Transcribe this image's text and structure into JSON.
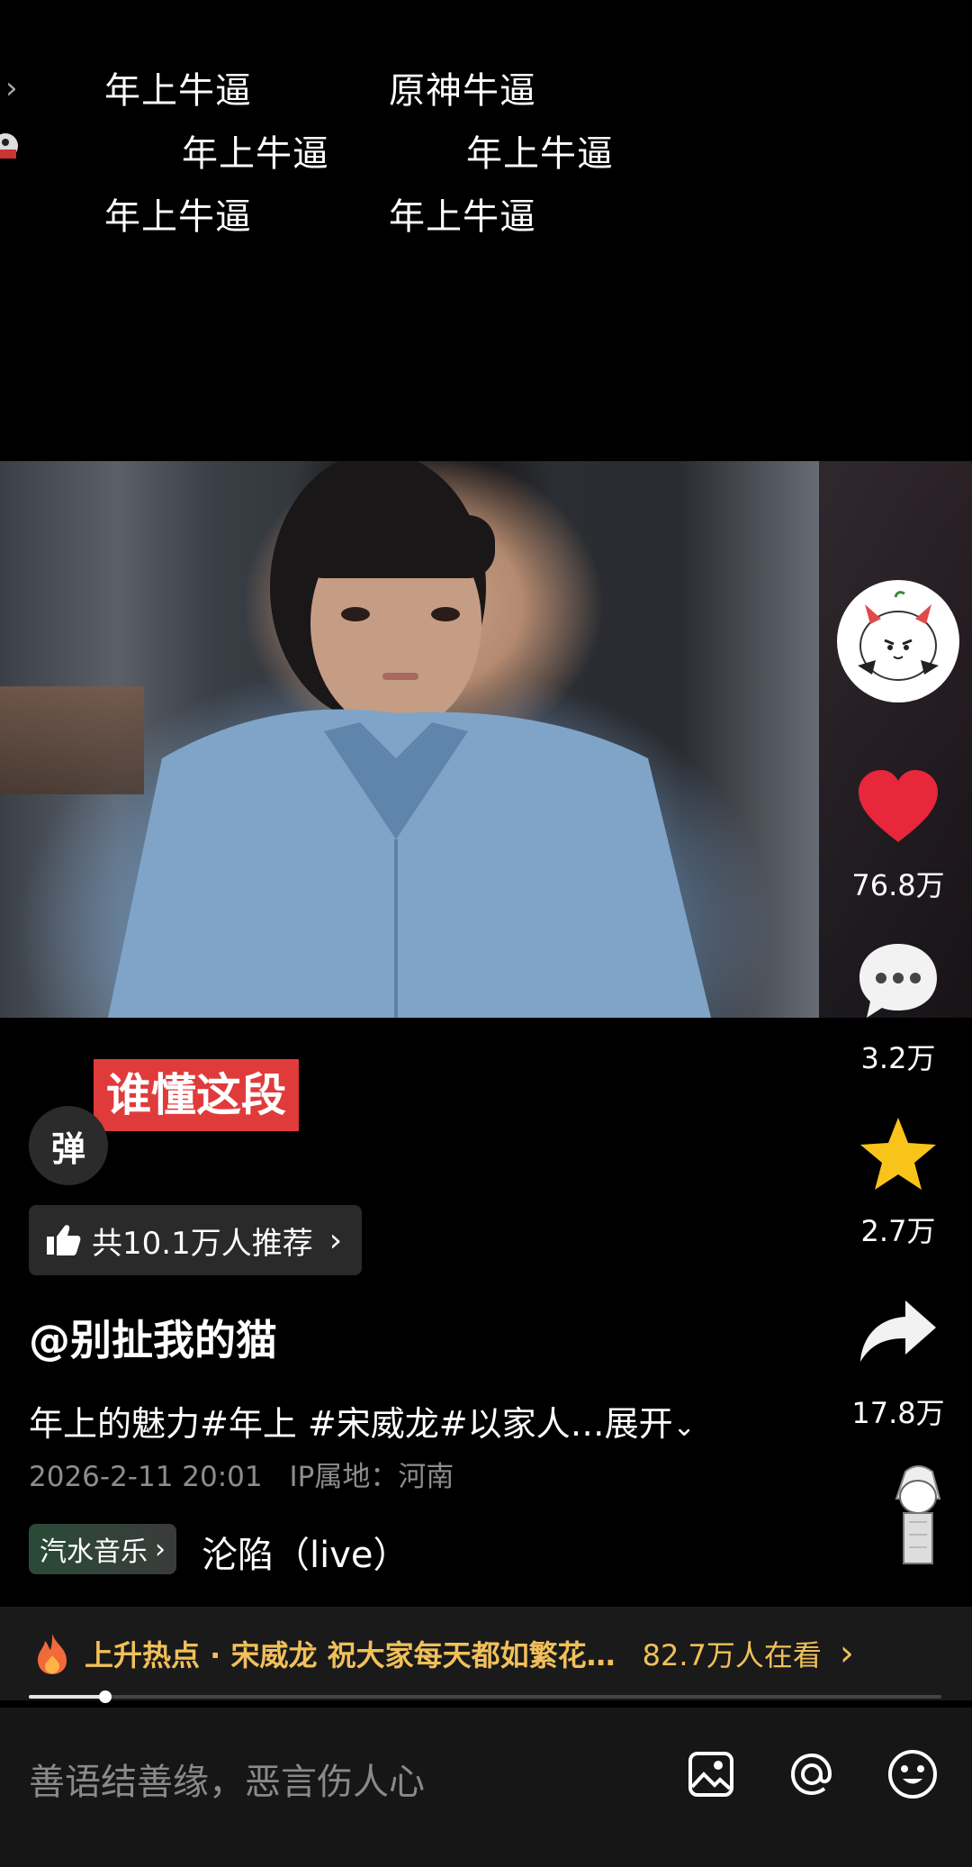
{
  "danmu": {
    "line1_a": "年上牛逼",
    "line1_b": "原神牛逼",
    "line2_a": "年上牛逼",
    "line2_b": "年上牛逼",
    "line3_a": "年上牛逼",
    "line3_b": "年上牛逼"
  },
  "top_left": {
    "chevron": "›"
  },
  "sidebar": {
    "avatar_icon": "devil-sticker-avatar",
    "likes": "76.8万",
    "comments": "3.2万",
    "favorites": "2.7万",
    "shares": "17.8万",
    "like_color": "#e8263c",
    "star_color": "#f8c41a"
  },
  "video": {
    "tag_label": "谁懂这段"
  },
  "danmu_toggle": {
    "label": "弹"
  },
  "recommend": {
    "label": "共10.1万人推荐"
  },
  "post": {
    "username": "@别扯我的猫",
    "description": "年上的魅力#年上 #宋威龙#以家人…",
    "expand_label": "展开",
    "date": "2026-2-11 20:01",
    "ip": "IP属地：河南"
  },
  "music": {
    "app_label": "汽水音乐",
    "song": "沦陷（live）"
  },
  "hot": {
    "text": "上升热点 · 宋威龙 祝大家每天都如繁花…",
    "viewers": "82.7万人在看"
  },
  "comment_bar": {
    "placeholder": "善语结善缘，恶言伤人心"
  }
}
